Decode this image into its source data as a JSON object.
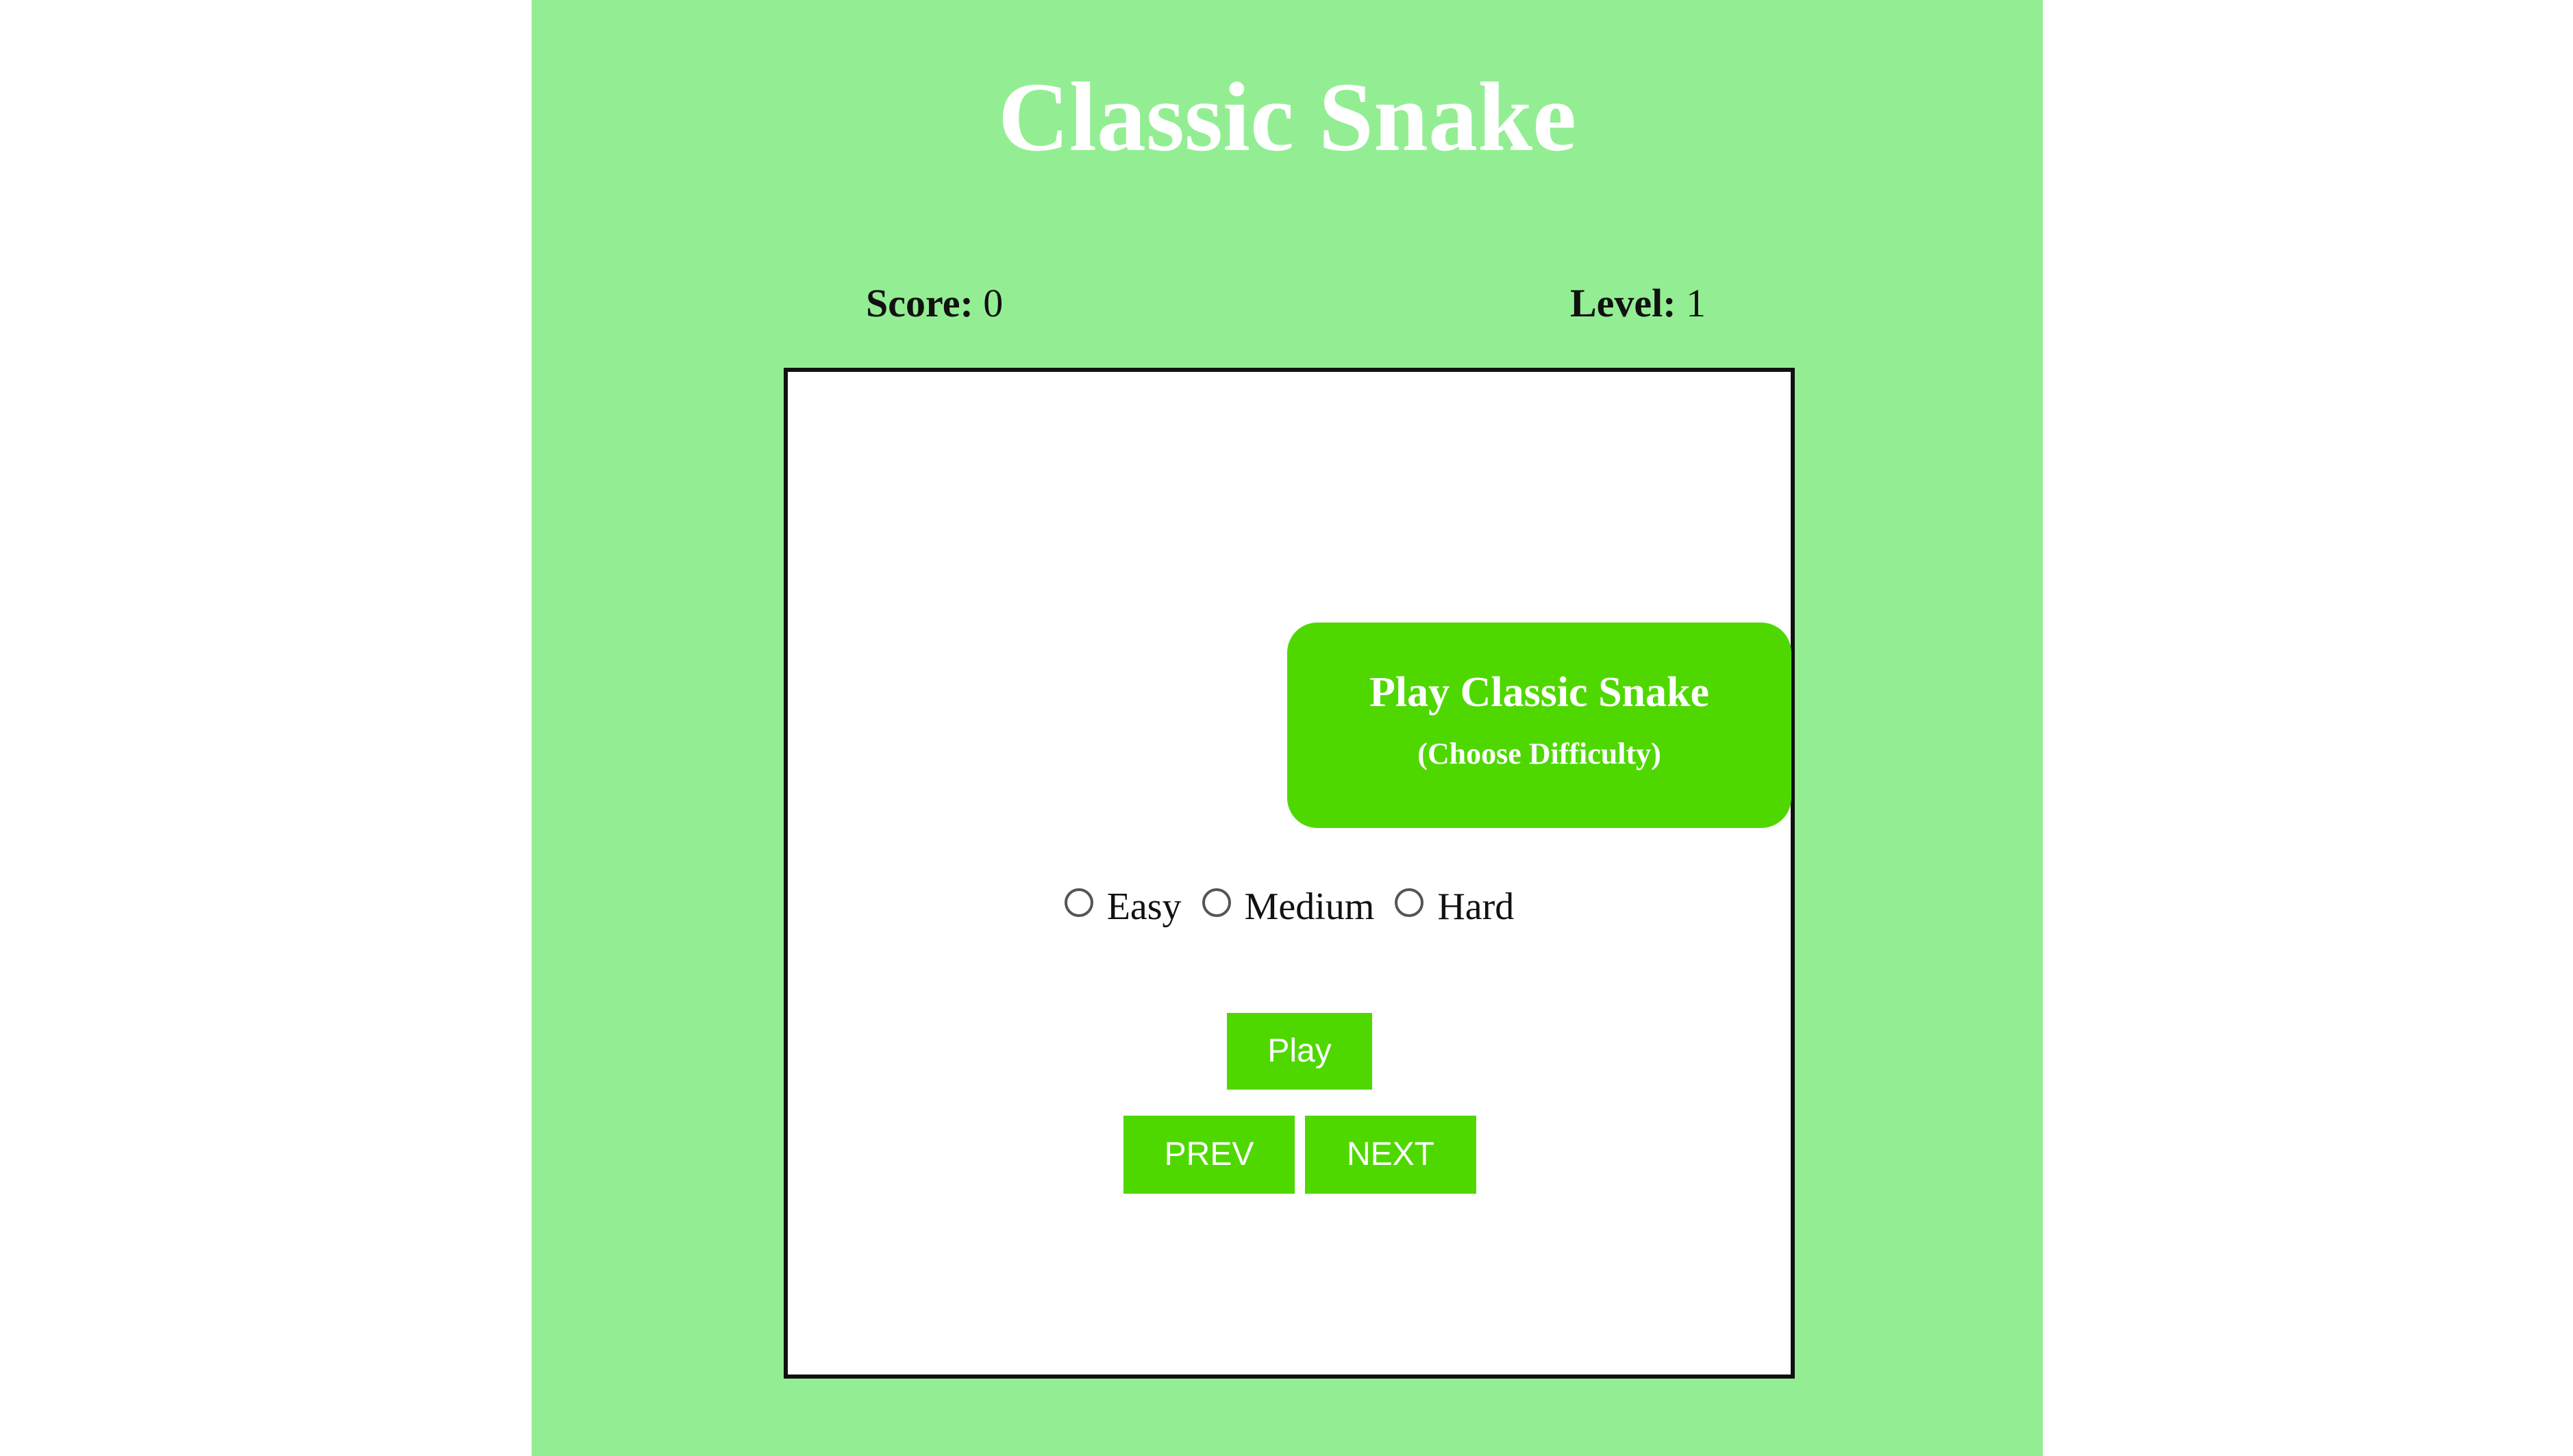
{
  "page": {
    "title": "Classic Snake"
  },
  "stats": {
    "score_label": "Score:",
    "score_value": "0",
    "level_label": "Level:",
    "level_value": "1"
  },
  "menu": {
    "heading": "Play Classic Snake",
    "subheading": "(Choose Difficulty)",
    "difficulty_options": [
      {
        "label": "Easy",
        "selected": false
      },
      {
        "label": "Medium",
        "selected": false
      },
      {
        "label": "Hard",
        "selected": false
      }
    ],
    "play_label": "Play",
    "prev_label": "PREV",
    "next_label": "NEXT"
  },
  "colors": {
    "panel_background": "#93ee93",
    "accent_green": "#4fd800",
    "title_text": "#ffffff",
    "board_border": "#111111"
  }
}
